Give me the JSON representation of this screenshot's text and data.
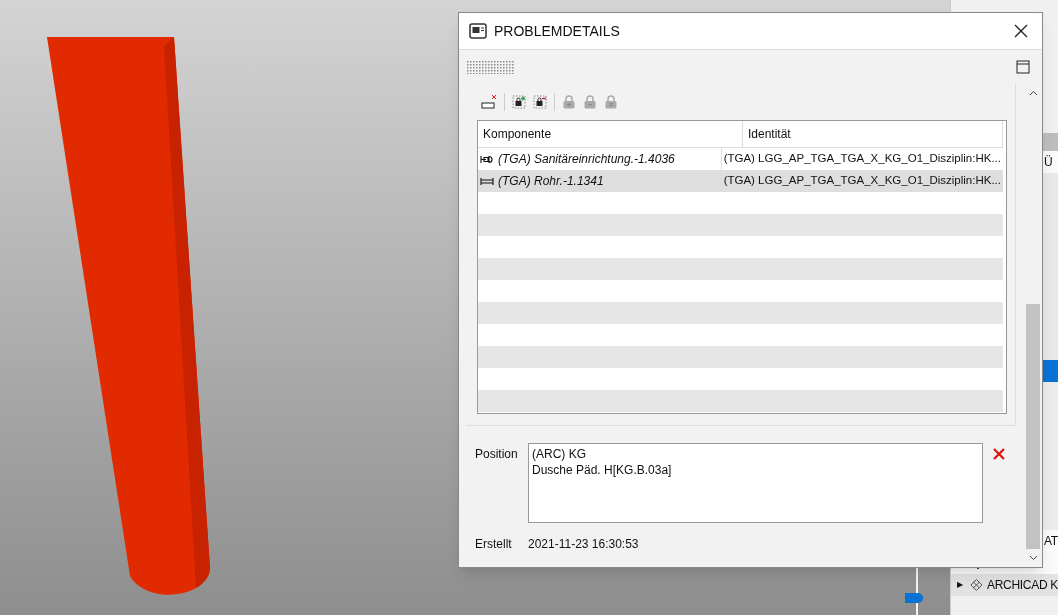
{
  "dialog": {
    "title": "PROBLEMDETAILS",
    "table": {
      "columns": [
        "Komponente",
        "Identität"
      ],
      "rows": [
        {
          "kind": "fixture",
          "component": "(TGA) Sanitäreinrichtung.-1.4036",
          "identity": "(TGA) LGG_AP_TGA_TGA_X_KG_O1_Disziplin:HK...",
          "selected": false
        },
        {
          "kind": "pipe",
          "component": "(TGA) Rohr.-1.1341",
          "identity": "(TGA) LGG_AP_TGA_TGA_X_KG_O1_Disziplin:HK...",
          "selected": true
        }
      ]
    },
    "position": {
      "label": "Position",
      "value": "(ARC) KG\nDusche Päd. H[KG.B.03a]"
    },
    "created": {
      "label": "Erstellt",
      "value": "2021-11-23 16:30:53"
    }
  },
  "side_panel": {
    "items": [
      {
        "kind": "label",
        "text": "Ü",
        "selected": false
      },
      {
        "kind": "label",
        "selected": true
      },
      {
        "kind": "label",
        "text": "AT",
        "selected": false
      },
      {
        "kind": "icon",
        "selected": false
      },
      {
        "kind": "tree",
        "expander": "▶",
        "text": "ARCHICAD K",
        "selected": false
      }
    ]
  }
}
